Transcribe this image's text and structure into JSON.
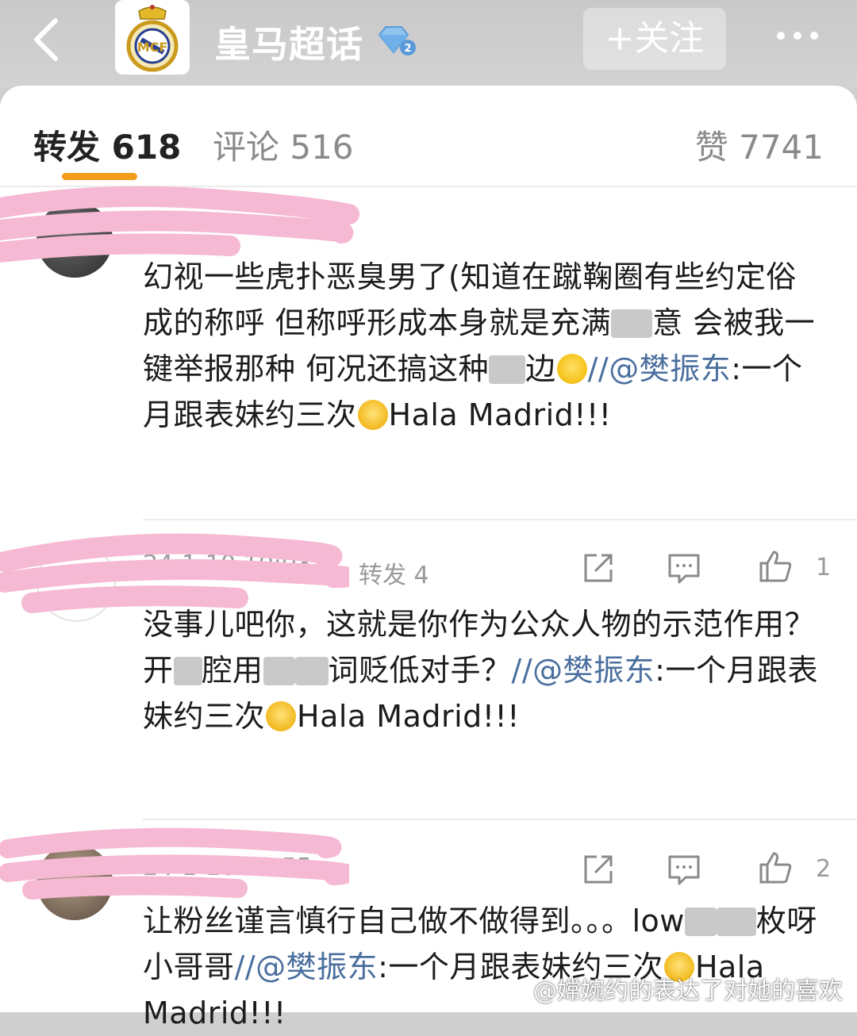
{
  "header": {
    "topic_title": "皇马超话",
    "follow_label": "+关注"
  },
  "tabs": {
    "repost": "转发 618",
    "comment": "评论 516",
    "like": "赞 7741"
  },
  "comments": [
    {
      "text_1": "幻视一些虎扑恶臭男了(知道在蹴鞠圈有些约定俗成的称呼 但称呼形成本身就是充满",
      "text_2": "意 会被我一键举报那种 何况还搞这种",
      "text_3": "边",
      "mention": "//@樊振东",
      "quote": ":一个月跟表妹约三次",
      "tail": "Hala Madrid!!!",
      "time": "24-1-10 10:03",
      "repost_label": "转发 4",
      "likes": "1"
    },
    {
      "username_fragment": "1",
      "text_1": "没事儿吧你，这就是你作为公众人物的示范作用？开",
      "text_2": "腔用",
      "text_3": "词贬低对手？",
      "mention": "//@樊振东",
      "quote": ":一个月跟表妹约三次",
      "tail": "Hala Madrid!!!",
      "time": "24-1-10 09:55",
      "likes": "2"
    },
    {
      "text_1": "让粉丝谨言慎行自己做不做得到。。。low",
      "text_2": "枚呀小哥哥",
      "mention": "//@樊振东",
      "quote": ":一个月跟表妹约三次",
      "tail": "Hala Madrid!!!"
    }
  ],
  "watermark": "@嫦婉约的表达了对她的喜欢"
}
